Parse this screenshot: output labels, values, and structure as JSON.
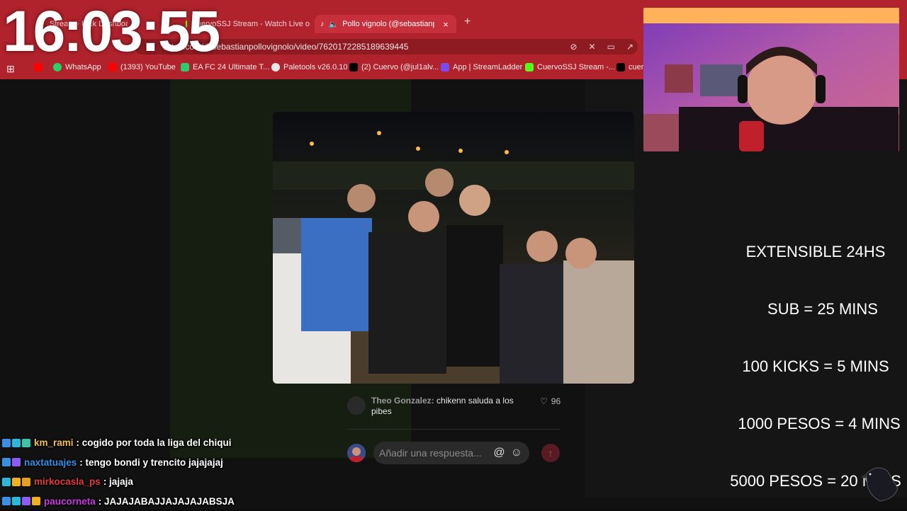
{
  "clock": "16:03:55",
  "browser": {
    "tabs": [
      {
        "label": "Stream · Kick Dashboard",
        "active": false
      },
      {
        "label": "CuervoSSJ Stream - Watch Live o",
        "active": false
      },
      {
        "label": "Pollo vignolo (@sebastianpoll",
        "active": true
      }
    ],
    "new_tab": "+",
    "close_tab": "×",
    "url": "tiktok.com/@sebastianpollovignolo/video/7620172285189639445",
    "bookmarks": [
      {
        "label": "WhatsApp",
        "color": "#25d366"
      },
      {
        "label": "(1393) YouTube",
        "color": "#ff0000"
      },
      {
        "label": "EA FC 24 Ultimate T...",
        "color": "#2ecc71"
      },
      {
        "label": "Paletools v26.0.10",
        "color": "#e8e8e8"
      },
      {
        "label": "(2) Cuervo (@jul1alv...",
        "color": "#000000"
      },
      {
        "label": "App | StreamLadder",
        "color": "#7b4df0"
      },
      {
        "label": "CuervoSSJ Stream -...",
        "color": "#53fc18"
      },
      {
        "label": "cuer",
        "color": "#000000"
      }
    ]
  },
  "overlay_lines": [
    "EXTENSIBLE 24HS",
    "SUB = 25 MINS",
    "100 KICKS = 5 MINS",
    "1000 PESOS = 4 MINS",
    "5000 PESOS = 20 MINS"
  ],
  "comment": {
    "user": "Theo Gonzalez:",
    "text": "chikenn saluda a los pibes",
    "likes": "96"
  },
  "reply": {
    "placeholder": "Añadir una respuesta..."
  },
  "chat": [
    {
      "user": "km_rami",
      "color": "#f0c050",
      "msg": ": cogido por toda la liga del chiqui",
      "badges": [
        "#3a8ee6",
        "#2bb8d8",
        "#3fc1a8"
      ]
    },
    {
      "user": "naxtatuajes",
      "color": "#3a8ee6",
      "msg": ": tengo bondi y trencito jajajajaj",
      "badges": [
        "#3a8ee6",
        "#8b5cf6"
      ]
    },
    {
      "user": "mirkocasla_ps",
      "color": "#e03a3a",
      "msg": ": jajaja",
      "badges": [
        "#2bb8d8",
        "#f0b020",
        "#e8a020"
      ]
    },
    {
      "user": "paucorneta",
      "color": "#c83ae0",
      "msg": ": JAJAJABAJJAJAJAJABSJA",
      "badges": [
        "#3a8ee6",
        "#2bb8d8",
        "#8b5cf6",
        "#f0b020"
      ]
    }
  ]
}
